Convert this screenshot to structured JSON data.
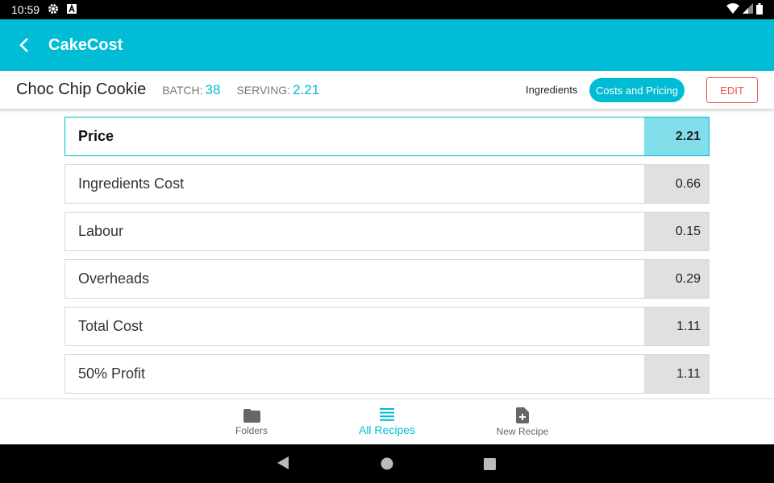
{
  "status_bar": {
    "time": "10:59"
  },
  "app_bar": {
    "title": "CakeCost"
  },
  "recipe": {
    "name": "Choc Chip Cookie",
    "batch_label": "BATCH:",
    "batch_value": "38",
    "serving_label": "SERVING:",
    "serving_value": "2.21"
  },
  "tabs": {
    "ingredients": "Ingredients",
    "costs_pricing": "Costs and Pricing"
  },
  "edit_label": "EDIT",
  "costs": [
    {
      "label": "Price",
      "value": "2.21"
    },
    {
      "label": "Ingredients Cost",
      "value": "0.66"
    },
    {
      "label": "Labour",
      "value": "0.15"
    },
    {
      "label": "Overheads",
      "value": "0.29"
    },
    {
      "label": "Total Cost",
      "value": "1.11"
    },
    {
      "label": "50% Profit",
      "value": "1.11"
    }
  ],
  "bottom_nav": {
    "folders": "Folders",
    "all_recipes": "All Recipes",
    "new_recipe": "New Recipe"
  },
  "colors": {
    "accent": "#00bcd4",
    "highlight_value": "#80deea",
    "edit": "#ef5350"
  }
}
